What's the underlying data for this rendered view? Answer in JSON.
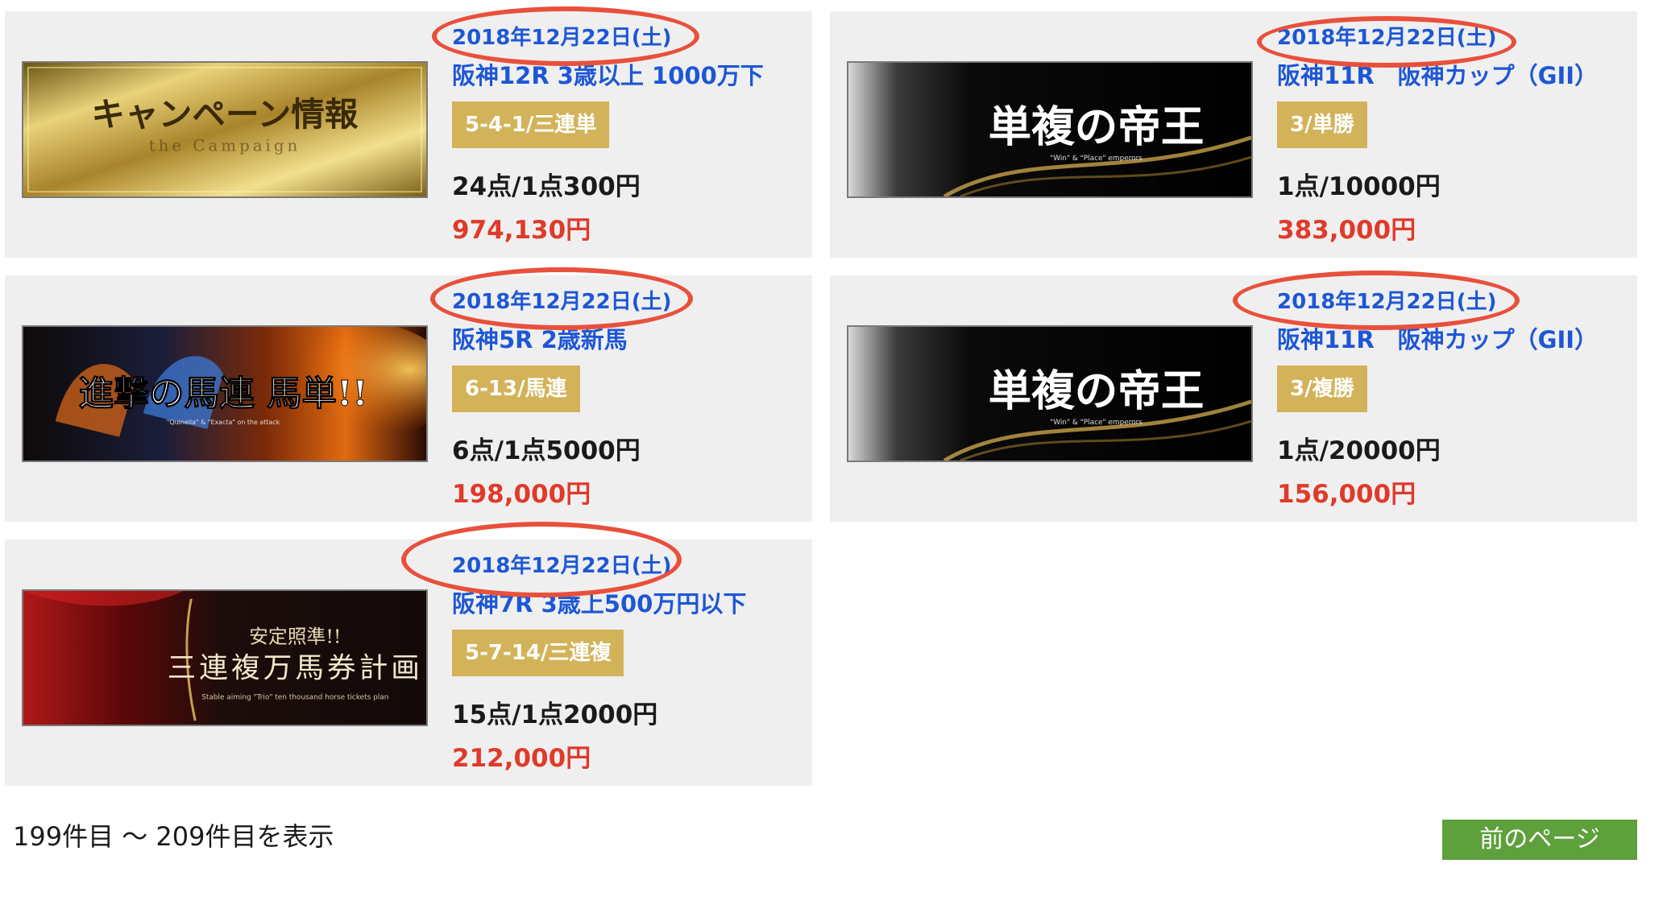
{
  "cards": [
    {
      "date": "2018年12月22日(土)",
      "race": "阪神12R 3歳以上 1000万下",
      "bet": "5-4-1/三連単",
      "points": "24点/1点300円",
      "payout": "974,130円",
      "banner": {
        "title": "キャンペーン情報",
        "subtitle": "the Campaign"
      }
    },
    {
      "date": "2018年12月22日(土)",
      "race": "阪神11R　阪神カップ（GII）",
      "bet": "3/単勝",
      "points": "1点/10000円",
      "payout": "383,000円",
      "banner": {
        "title": "単複の帝王",
        "subtitle": "\"Win\" & \"Place\" emperors"
      }
    },
    {
      "date": "2018年12月22日(土)",
      "race": "阪神5R 2歳新馬",
      "bet": "6-13/馬連",
      "points": "6点/1点5000円",
      "payout": "198,000円",
      "banner": {
        "title": "進撃の馬連 馬単!!",
        "subtitle": "\"Quinella\" & \"Exacta\" on the attack"
      }
    },
    {
      "date": "2018年12月22日(土)",
      "race": "阪神11R　阪神カップ（GII）",
      "bet": "3/複勝",
      "points": "1点/20000円",
      "payout": "156,000円",
      "banner": {
        "title": "単複の帝王",
        "subtitle": "\"Win\" & \"Place\" emperors"
      }
    },
    {
      "date": "2018年12月22日(土)",
      "race": "阪神7R 3歳上500万円以下",
      "bet": "5-7-14/三連複",
      "points": "15点/1点2000円",
      "payout": "212,000円",
      "banner": {
        "title": "三連複万馬券計画",
        "tagline": "安定照準!!",
        "subtitle": "Stable aiming \"Trio\" ten thousand horse tickets plan"
      }
    }
  ],
  "pagination": {
    "range_text": "199件目 ～ 209件目を表示",
    "prev_label": "前のページ"
  },
  "colors": {
    "link_blue": "#1d57d6",
    "bet_badge": "#d3b35a",
    "payout_red": "#e03a2a",
    "annotation_red": "#e8503c",
    "button_green": "#5ea03c",
    "card_bg": "#efefef"
  }
}
